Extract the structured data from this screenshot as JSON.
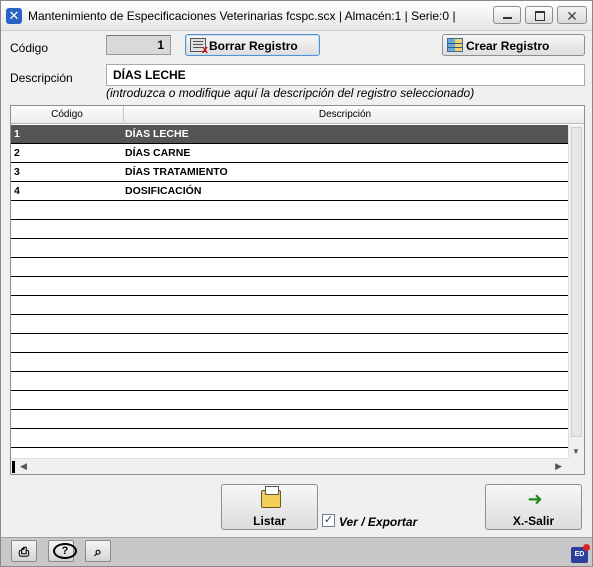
{
  "window": {
    "app_icon": "x-app-icon",
    "title": "Mantenimiento de Especificaciones Veterinarias fcspc.scx   | Almacén:1 | Serie:0 |",
    "controls": [
      "minimize-icon",
      "maximize-icon",
      "close-icon"
    ],
    "close_glyph": "✕"
  },
  "form": {
    "codigo_label": "Código",
    "codigo_value": "1",
    "descripcion_label": "Descripción",
    "descripcion_value": "DÍAS LECHE",
    "hint": "(introduzca o modifique aquí la descripción del registro seleccionado)",
    "borrar_label": "Borrar Registro",
    "crear_label": "Crear Registro"
  },
  "grid": {
    "columns": [
      "Código",
      "Descripción"
    ],
    "rows": [
      {
        "codigo": "1",
        "descripcion": "DÍAS LECHE",
        "selected": true
      },
      {
        "codigo": "2",
        "descripcion": "DÍAS CARNE"
      },
      {
        "codigo": "3",
        "descripcion": "DÍAS TRATAMIENTO"
      },
      {
        "codigo": "4",
        "descripcion": "DOSIFICACIÓN"
      }
    ],
    "selected_color": "#555555"
  },
  "actions": {
    "listar_label": "Listar",
    "ver_exportar_label": "Ver / Exportar",
    "ver_exportar_checked": true,
    "salir_label": "X.-Salir"
  },
  "statusbar": {
    "icons": [
      "printer-icon",
      "help-icon",
      "search-icon"
    ],
    "badge": "ED"
  }
}
